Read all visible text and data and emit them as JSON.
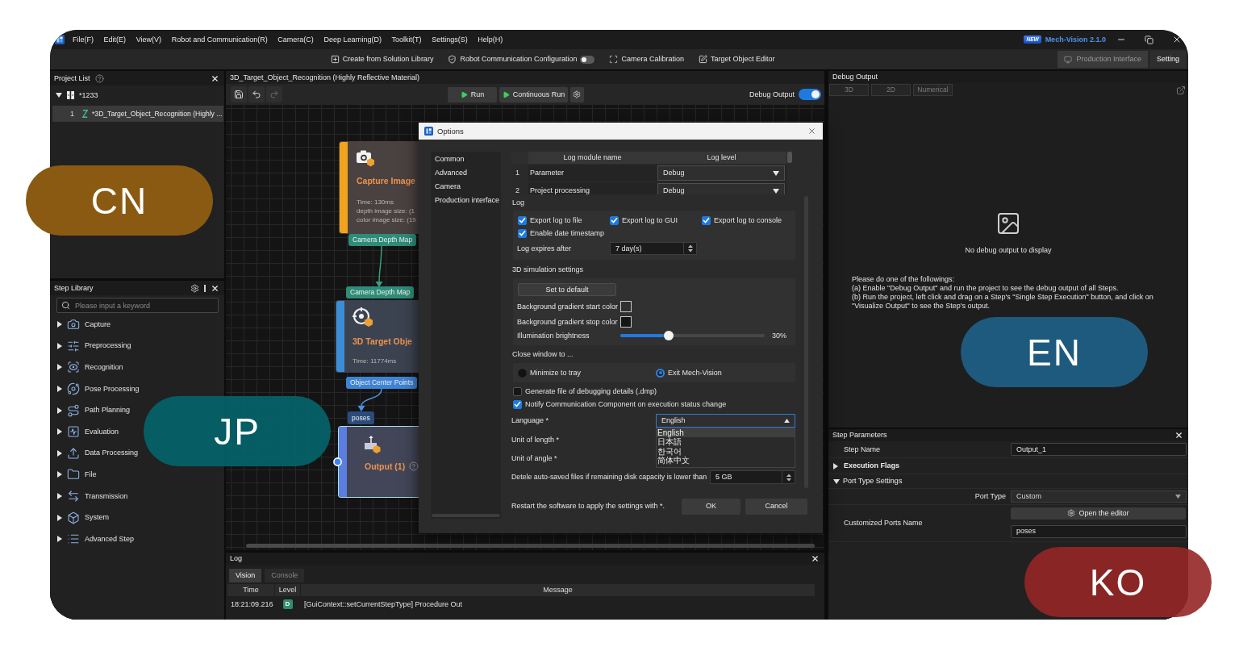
{
  "menu_bar": {
    "items": [
      "File(F)",
      "Edit(E)",
      "View(V)",
      "Robot and Communication(R)",
      "Camera(C)",
      "Deep Learning(D)",
      "Toolkit(T)",
      "Settings(S)",
      "Help(H)"
    ],
    "badge": "NEW",
    "version": "Mech-Vision 2.1.0"
  },
  "toolbar": {
    "solution_library": "Create from Solution Library",
    "robot_communication": {
      "label": "Robot Communication Configuration",
      "on": false
    },
    "camera_calibration": "Camera Calibration",
    "target_object_editor": "Target Object Editor",
    "view_tabs": [
      {
        "label": "Production Interface",
        "selected": false
      },
      {
        "label": "Setting",
        "selected": true
      }
    ]
  },
  "project_list": {
    "title": "Project List",
    "projects": [
      {
        "name": "*1233",
        "expanded": true,
        "children": [
          {
            "number": "1",
            "name": "*3D_Target_Object_Recognition (Highly ...",
            "selected": true
          }
        ]
      }
    ]
  },
  "step_library": {
    "title": "Step Library",
    "search": {
      "placeholder": "Please input a keyword"
    },
    "categories": [
      {
        "label": "Capture",
        "expanded": false
      },
      {
        "label": "Preprocessing",
        "expanded": false
      },
      {
        "label": "Recognition",
        "expanded": false
      },
      {
        "label": "Pose Processing",
        "expanded": false
      },
      {
        "label": "Path Planning",
        "expanded": false
      },
      {
        "label": "Evaluation",
        "expanded": false
      },
      {
        "label": "Data Processing",
        "expanded": false
      },
      {
        "label": "File",
        "expanded": false
      },
      {
        "label": "Transmission",
        "expanded": false
      },
      {
        "label": "System",
        "expanded": false
      },
      {
        "label": "Advanced Step",
        "expanded": false
      }
    ]
  },
  "editor": {
    "title": "3D_Target_Object_Recognition (Highly Reflective Material)",
    "run": "Run",
    "continuous_run": "Continuous Run",
    "debug_output": {
      "label": "Debug Output",
      "on": true
    },
    "nodes": [
      {
        "kind": "capture",
        "title": "Capture Image",
        "info": [
          "Time: 130ms",
          "depth image size: (1",
          "color image size: (19"
        ],
        "outputs": [
          "Camera Depth Map"
        ],
        "selected": false
      },
      {
        "kind": "recognition",
        "title": "3D Target Obje",
        "info": [
          "Time: 11774ms"
        ],
        "inputs": [
          "Camera Depth Map"
        ],
        "outputs": [
          "Object Center Points"
        ],
        "selected": false
      },
      {
        "kind": "output",
        "title": "Output (1)",
        "inputs": [
          "poses"
        ],
        "selected": true
      }
    ]
  },
  "options_dialog": {
    "title": "Options",
    "nav": [
      "Common",
      "Advanced",
      "Camera",
      "Production interface"
    ],
    "log_modules": {
      "columns": [
        "Log module name",
        "Log level"
      ],
      "rows": [
        {
          "number": "1",
          "name": "Parameter",
          "level": "Debug"
        },
        {
          "number": "2",
          "name": "Project processing",
          "level": "Debug"
        }
      ]
    },
    "log": {
      "title": "Log",
      "outputs": [
        {
          "label": "Export log to file",
          "checked": true
        },
        {
          "label": "Export log to GUI",
          "checked": true
        },
        {
          "label": "Export log to console",
          "checked": true
        },
        {
          "label": "Enable date timestamp",
          "checked": true
        }
      ],
      "expiry": {
        "label": "Log expires after",
        "value": "7 day(s)"
      }
    },
    "simulation": {
      "title": "3D simulation settings",
      "reset": "Set to default",
      "gradient": [
        {
          "label": "Background gradient start color",
          "color": "#303030"
        },
        {
          "label": "Background gradient stop color",
          "color": "#161616"
        }
      ],
      "brightness": {
        "label": "Illumination brightness",
        "level": 0.3,
        "reading": "30%"
      }
    },
    "close_window": {
      "title": "Close window to ...",
      "options": [
        {
          "label": "Minimize to tray",
          "selected": false
        },
        {
          "label": "Exit Mech-Vision",
          "selected": true
        }
      ]
    },
    "flags": [
      {
        "label": "Generate file of debugging details (.dmp)",
        "checked": false
      },
      {
        "label": "Notify Communication Component on execution status change",
        "checked": true
      }
    ],
    "language": {
      "label": "Language *",
      "value": "English",
      "expanded": true,
      "options": [
        {
          "label": "English",
          "selected": true
        },
        {
          "label": "日本語",
          "selected": false
        },
        {
          "label": "한국어",
          "selected": false
        },
        {
          "label": "简体中文",
          "selected": false
        }
      ]
    },
    "units": [
      "Unit of length *",
      "Unit of angle *"
    ],
    "disk_limit": {
      "label": "Detele auto-saved files if remaining disk capacity is lower than",
      "value": "5 GB"
    },
    "note": "Restart the software to apply the settings with *.",
    "buttons": [
      "OK",
      "Cancel"
    ]
  },
  "debug_output": {
    "title": "Debug Output",
    "tabs": [
      {
        "label": "3D",
        "disabled": true
      },
      {
        "label": "2D",
        "disabled": true
      },
      {
        "label": "Numerical",
        "disabled": true
      }
    ],
    "empty_message": "No debug output to display",
    "instructions": [
      "Please do one of the followings:",
      "(a) Enable \"Debug Output\" and run the project to see the debug output of all Steps.",
      "(b) Run the project, left click and drag on a Step's \"Single Step Execution\" button, and click on",
      "\"Visualize Output\" to see the Step's output."
    ]
  },
  "step_parameters": {
    "title": "Step Parameters",
    "step_name": {
      "label": "Step Name",
      "value": "Output_1"
    },
    "execution_flags": {
      "label": "Execution Flags",
      "expanded": false
    },
    "port_type_settings": {
      "label": "Port Type Settings",
      "expanded": true,
      "port_type": {
        "label": "Port Type",
        "value": "Custom"
      },
      "custom_ports": {
        "label": "Customized Ports Name",
        "editor_button": "Open the editor",
        "value": "poses"
      }
    }
  },
  "log": {
    "title": "Log",
    "tabs": [
      {
        "label": "Vision",
        "selected": true
      },
      {
        "label": "Console",
        "selected": false
      }
    ],
    "columns": [
      "Time",
      "Level",
      "Message"
    ],
    "rows": [
      {
        "time": "18:21:09.216",
        "level": "D",
        "message": "[GuiContext::setCurrentStepType] Procedure Out"
      }
    ]
  },
  "language_badges": [
    "CN",
    "JP",
    "EN",
    "KO"
  ]
}
